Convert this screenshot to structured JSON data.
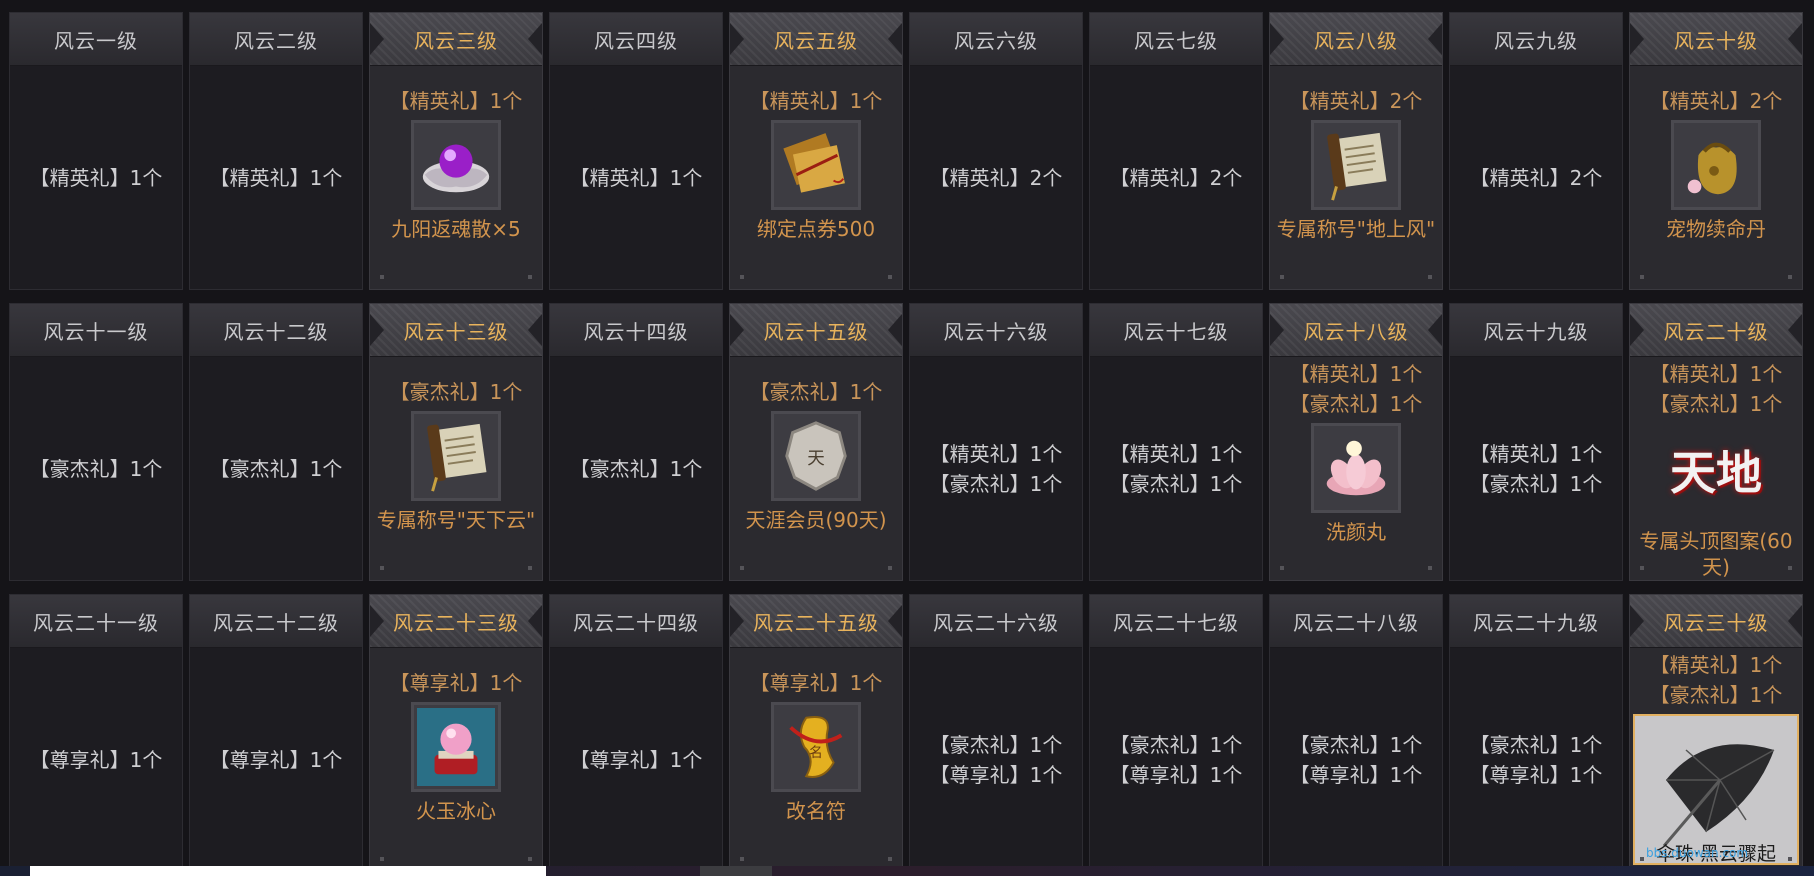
{
  "levels": [
    {
      "title": "风云一级",
      "highlight": false,
      "gifts": [
        "【精英礼】1个"
      ]
    },
    {
      "title": "风云二级",
      "highlight": false,
      "gifts": [
        "【精英礼】1个"
      ]
    },
    {
      "title": "风云三级",
      "highlight": true,
      "gifts": [
        "【精英礼】1个"
      ],
      "item": {
        "icon": "purple-pearl-shell-icon",
        "name": "九阳返魂散×5"
      }
    },
    {
      "title": "风云四级",
      "highlight": false,
      "gifts": [
        "【精英礼】1个"
      ]
    },
    {
      "title": "风云五级",
      "highlight": true,
      "gifts": [
        "【精英礼】1个"
      ],
      "item": {
        "icon": "bound-voucher-icon",
        "name": "绑定点券500"
      }
    },
    {
      "title": "风云六级",
      "highlight": false,
      "gifts": [
        "【精英礼】2个"
      ]
    },
    {
      "title": "风云七级",
      "highlight": false,
      "gifts": [
        "【精英礼】2个"
      ]
    },
    {
      "title": "风云八级",
      "highlight": true,
      "gifts": [
        "【精英礼】2个"
      ],
      "item": {
        "icon": "title-scroll-icon",
        "name": "专属称号\"地上风\""
      }
    },
    {
      "title": "风云九级",
      "highlight": false,
      "gifts": [
        "【精英礼】2个"
      ]
    },
    {
      "title": "风云十级",
      "highlight": true,
      "gifts": [
        "【精英礼】2个"
      ],
      "item": {
        "icon": "pet-pill-bag-icon",
        "name": "宠物续命丹"
      }
    },
    {
      "title": "风云十一级",
      "highlight": false,
      "gifts": [
        "【豪杰礼】1个"
      ]
    },
    {
      "title": "风云十二级",
      "highlight": false,
      "gifts": [
        "【豪杰礼】1个"
      ]
    },
    {
      "title": "风云十三级",
      "highlight": true,
      "gifts": [
        "【豪杰礼】1个"
      ],
      "item": {
        "icon": "title-scroll-icon",
        "name": "专属称号\"天下云\""
      }
    },
    {
      "title": "风云十四级",
      "highlight": false,
      "gifts": [
        "【豪杰礼】1个"
      ]
    },
    {
      "title": "风云十五级",
      "highlight": true,
      "gifts": [
        "【豪杰礼】1个"
      ],
      "item": {
        "icon": "member-medal-icon",
        "name": "天涯会员(90天)"
      }
    },
    {
      "title": "风云十六级",
      "highlight": false,
      "gifts": [
        "【精英礼】1个",
        "【豪杰礼】1个"
      ]
    },
    {
      "title": "风云十七级",
      "highlight": false,
      "gifts": [
        "【精英礼】1个",
        "【豪杰礼】1个"
      ]
    },
    {
      "title": "风云十八级",
      "highlight": true,
      "gifts": [
        "【精英礼】1个",
        "【豪杰礼】1个"
      ],
      "item": {
        "icon": "lotus-pill-icon",
        "name": "洗颜丸"
      }
    },
    {
      "title": "风云十九级",
      "highlight": false,
      "gifts": [
        "【精英礼】1个",
        "【豪杰礼】1个"
      ]
    },
    {
      "title": "风云二十级",
      "highlight": true,
      "gifts": [
        "【精英礼】1个",
        "【豪杰礼】1个"
      ],
      "item": {
        "icon": "head-emblem-icon",
        "name": "专属头顶图案(60天)"
      }
    },
    {
      "title": "风云二十一级",
      "highlight": false,
      "gifts": [
        "【尊享礼】1个"
      ]
    },
    {
      "title": "风云二十二级",
      "highlight": false,
      "gifts": [
        "【尊享礼】1个"
      ]
    },
    {
      "title": "风云二十三级",
      "highlight": true,
      "gifts": [
        "【尊享礼】1个"
      ],
      "item": {
        "icon": "fire-jade-orb-icon",
        "name": "火玉冰心"
      }
    },
    {
      "title": "风云二十四级",
      "highlight": false,
      "gifts": [
        "【尊享礼】1个"
      ]
    },
    {
      "title": "风云二十五级",
      "highlight": true,
      "gifts": [
        "【尊享礼】1个"
      ],
      "item": {
        "icon": "rename-talisman-icon",
        "name": "改名符"
      }
    },
    {
      "title": "风云二十六级",
      "highlight": false,
      "gifts": [
        "【豪杰礼】1个",
        "【尊享礼】1个"
      ]
    },
    {
      "title": "风云二十七级",
      "highlight": false,
      "gifts": [
        "【豪杰礼】1个",
        "【尊享礼】1个"
      ]
    },
    {
      "title": "风云二十八级",
      "highlight": false,
      "gifts": [
        "【豪杰礼】1个",
        "【尊享礼】1个"
      ]
    },
    {
      "title": "风云二十九级",
      "highlight": false,
      "gifts": [
        "【豪杰礼】1个",
        "【尊享礼】1个"
      ]
    },
    {
      "title": "风云三十级",
      "highlight": true,
      "gifts": [
        "【精英礼】1个",
        "【豪杰礼】1个"
      ],
      "item": {
        "icon": "black-umbrella-icon",
        "name": "伞珠·黑云骤起"
      }
    }
  ],
  "emblem_text": "天地",
  "watermark": "bbs.duowan.com",
  "colors": {
    "accent": "#e8b35c",
    "gift_hl": "#c9955a",
    "item_name": "#d2944d"
  }
}
